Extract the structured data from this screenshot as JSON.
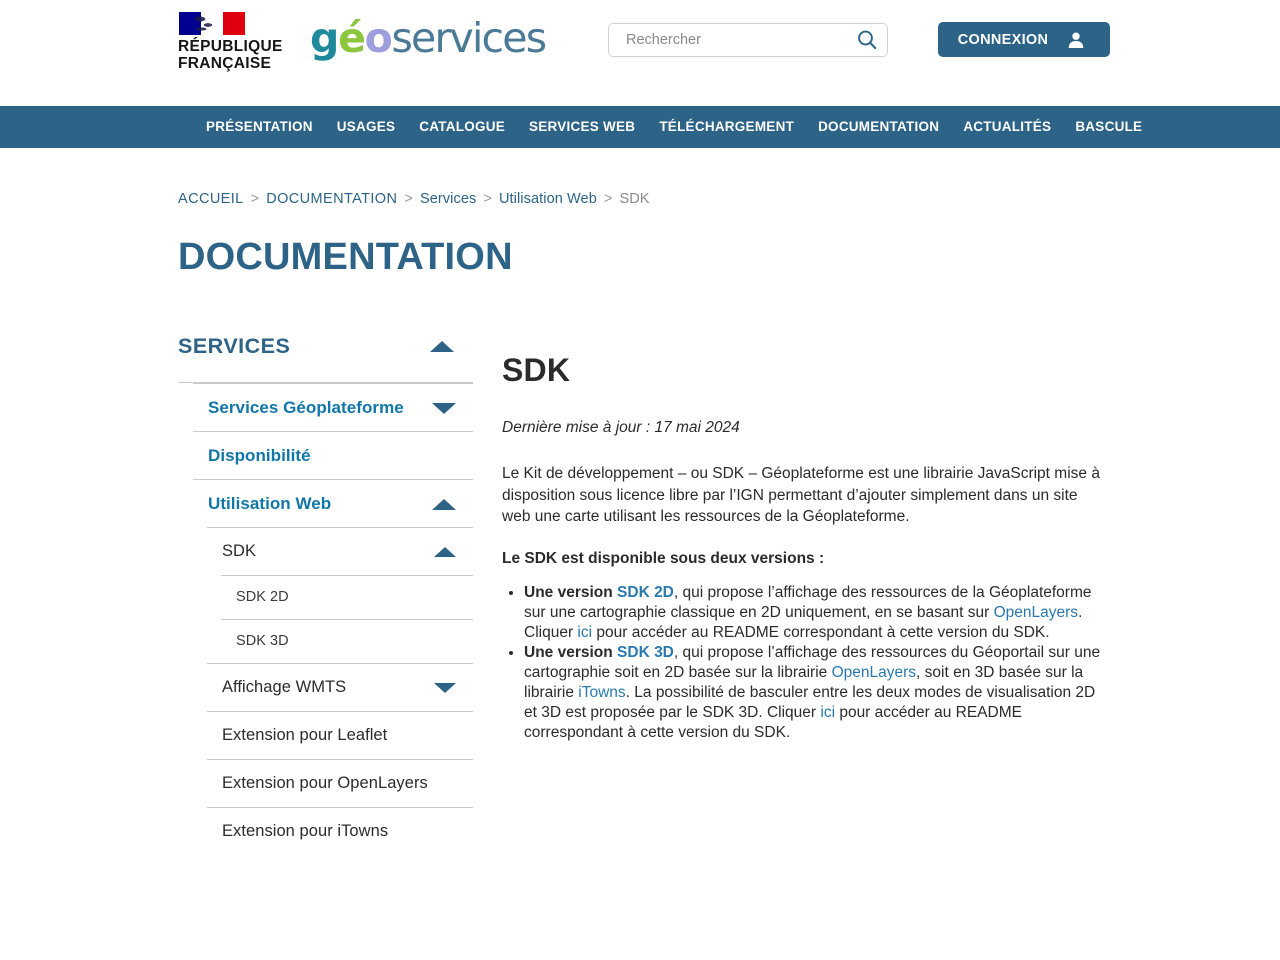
{
  "brand": {
    "republic_line1": "RÉPUBLIQUE",
    "republic_line2": "FRANÇAISE",
    "logo_g": "g",
    "logo_e": "é",
    "logo_o": "o",
    "logo_services": "services"
  },
  "search": {
    "placeholder": "Rechercher",
    "value": ""
  },
  "login": {
    "label": "CONNEXION"
  },
  "nav": {
    "items": [
      {
        "label": "PRÉSENTATION"
      },
      {
        "label": "USAGES"
      },
      {
        "label": "CATALOGUE"
      },
      {
        "label": "SERVICES WEB"
      },
      {
        "label": "TÉLÉCHARGEMENT"
      },
      {
        "label": "DOCUMENTATION"
      },
      {
        "label": "ACTUALITÉS"
      },
      {
        "label": "BASCULE"
      }
    ]
  },
  "breadcrumb": {
    "separator": ">",
    "items": [
      {
        "label": "ACCUEIL",
        "current": false
      },
      {
        "label": "DOCUMENTATION",
        "current": false
      },
      {
        "label": "Services",
        "current": false
      },
      {
        "label": "Utilisation Web",
        "current": false
      },
      {
        "label": "SDK",
        "current": true
      }
    ]
  },
  "page": {
    "title": "DOCUMENTATION"
  },
  "sidebar": {
    "title": "SERVICES",
    "title_caret": "caret-up-icon",
    "items": [
      {
        "label": "Services Géoplateforme",
        "caret": "caret-down-icon",
        "level": 1
      },
      {
        "label": "Disponibilité",
        "caret": "",
        "level": 1
      },
      {
        "label": "Utilisation Web",
        "caret": "caret-up-icon",
        "level": 1
      },
      {
        "label": "SDK",
        "caret": "caret-up-icon",
        "level": 2
      },
      {
        "label": "SDK 2D",
        "caret": "",
        "level": 3
      },
      {
        "label": "SDK 3D",
        "caret": "",
        "level": 3
      },
      {
        "label": "Affichage WMTS",
        "caret": "caret-down-icon",
        "level": 2
      },
      {
        "label": "Extension pour Leaflet",
        "caret": "",
        "level": 2
      },
      {
        "label": "Extension pour OpenLayers",
        "caret": "",
        "level": 2
      },
      {
        "label": "Extension pour iTowns",
        "caret": "",
        "level": 2
      }
    ]
  },
  "main": {
    "heading": "SDK",
    "updated": "Dernière mise à jour : 17 mai 2024",
    "intro": "Le Kit de développement – ou SDK – Géoplateforme est une librairie JavaScript mise à disposition sous licence libre par l’IGN permettant d’ajouter simplement dans un site web une carte utilisant les ressources de la Géoplateforme.",
    "lead": "Le SDK est disponible sous deux versions :",
    "bullets": [
      {
        "prefix_bold": "Une version ",
        "link_bold": "SDK 2D",
        "seg1": ", qui propose l’affichage des ressources de la Géoplateforme sur une cartographie classique en 2D uniquement, en se basant sur ",
        "link2": "OpenLayers",
        "seg2": ". Cliquer ",
        "link3": "ici",
        "seg3": " pour accéder au README correspondant à cette version du SDK."
      },
      {
        "prefix_bold": "Une version ",
        "link_bold": "SDK 3D",
        "seg1": ", qui propose l’affichage des ressources du Géoportail sur une cartographie soit en 2D basée sur la librairie ",
        "link2": "OpenLayers",
        "seg2": ", soit en 3D basée sur la librairie ",
        "link3": "iTowns",
        "seg3": ". La possibilité de basculer entre les deux modes de visualisation 2D et 3D est proposée par le SDK 3D. Cliquer ",
        "link4": "ici",
        "seg4": " pour accéder au README correspondant à cette version du SDK."
      }
    ]
  },
  "colors": {
    "brand_blue": "#2c6387",
    "link_blue": "#2a7ab0",
    "menu_blue": "#1176a8",
    "logo_teal": "#1f8a9c",
    "logo_green": "#8cc63f",
    "logo_purple": "#9e9ede",
    "logo_gray_blue": "#4a7a96",
    "flag_blue": "#000091",
    "flag_red": "#e1000f",
    "rule_gray": "#c9c9c9",
    "text_dark": "#2b2b2b",
    "text_muted": "#8a8a8a"
  }
}
